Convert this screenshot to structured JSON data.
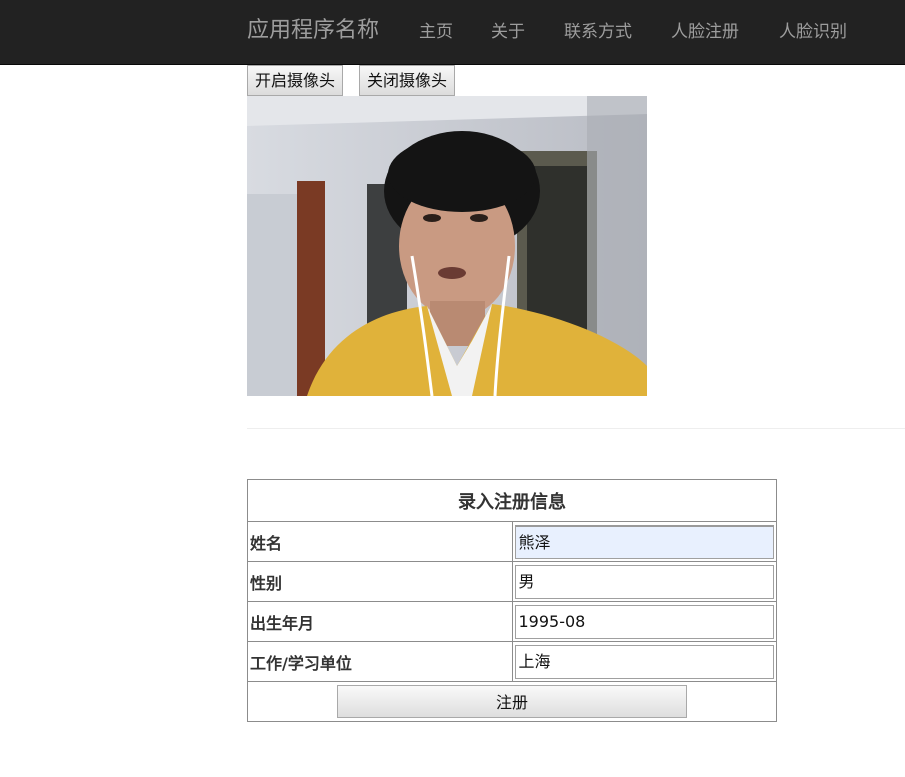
{
  "navbar": {
    "brand": "应用程序名称",
    "items": [
      {
        "label": "主页"
      },
      {
        "label": "关于"
      },
      {
        "label": "联系方式"
      },
      {
        "label": "人脸注册"
      },
      {
        "label": "人脸识别"
      }
    ]
  },
  "camera": {
    "open_label": "开启摄像头",
    "close_label": "关闭摄像头"
  },
  "form": {
    "title": "录入注册信息",
    "rows": [
      {
        "label": "姓名",
        "value": "熊泽"
      },
      {
        "label": "性别",
        "value": "男"
      },
      {
        "label": "出生年月",
        "value": "1995-08"
      },
      {
        "label": "工作/学习单位",
        "value": "上海"
      }
    ],
    "submit_label": "注册"
  },
  "colors": {
    "navbar_bg": "#222222",
    "nav_text": "#9d9d9d",
    "autofill_bg": "#e8f0fe"
  }
}
